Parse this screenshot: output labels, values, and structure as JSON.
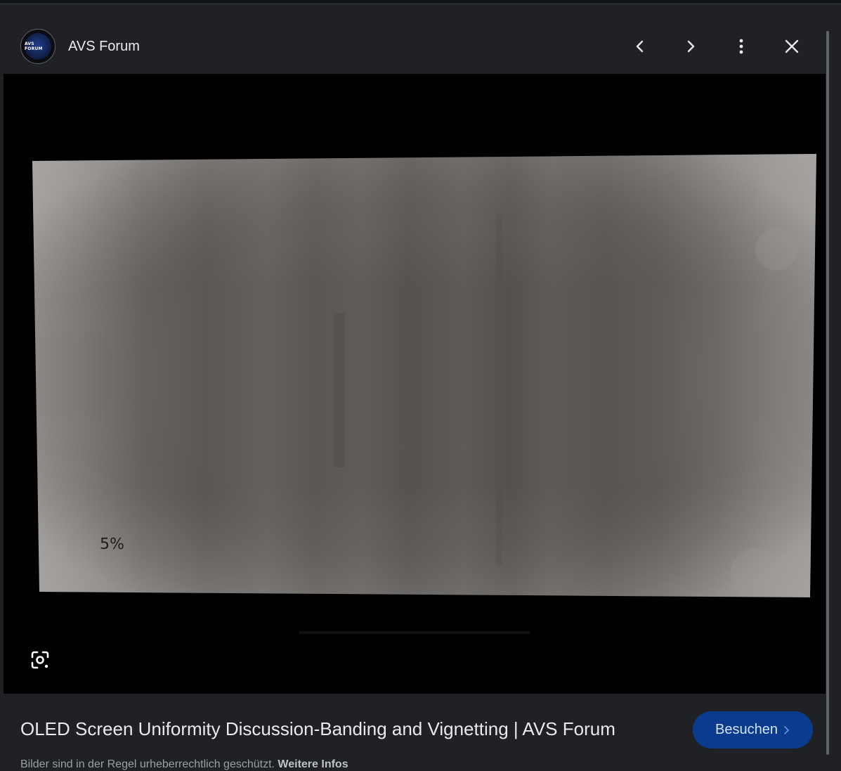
{
  "header": {
    "site_name": "AVS Forum",
    "avatar_logo_text": "AVS FORUM",
    "icons": {
      "prev": "chevron-left-icon",
      "next": "chevron-right-icon",
      "more": "more-vert-icon",
      "close": "close-icon"
    }
  },
  "viewer": {
    "image_overlay_text": "5%",
    "lens_icon": "lens-search-icon"
  },
  "caption": {
    "title": "OLED Screen Uniformity Discussion-Banding and Vignetting | AVS Forum",
    "visit_label": "Besuchen",
    "copyright_text": "Bilder sind in der Regel urheberrechtlich geschützt.",
    "more_info_label": "Weitere Infos"
  },
  "colors": {
    "background": "#202124",
    "accent_button": "#0b3b8c",
    "button_text": "#d2e3fc"
  }
}
